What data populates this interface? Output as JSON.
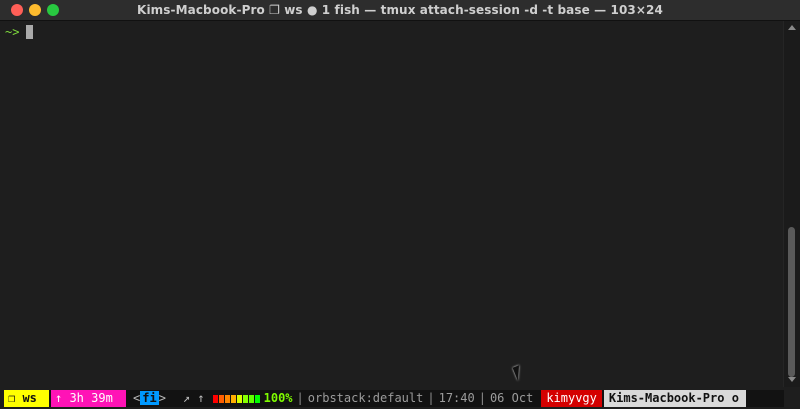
{
  "window": {
    "title": "Kims-Macbook-Pro ❐ ws ● 1 fish — tmux attach-session -d -t base — 103×24",
    "controls": {
      "close_color": "#ff5f57",
      "minimize_color": "#febc2e",
      "maximize_color": "#28c840"
    }
  },
  "terminal": {
    "prompt": "~>",
    "cursor_icon": "block-cursor-icon",
    "scrollbar": {
      "up_icon": "scroll-up-icon",
      "down_icon": "scroll-down-icon"
    }
  },
  "status": {
    "session": "❐ ws",
    "uptime": "↑ 3h 39m",
    "window_open": "<",
    "window_current": "fi",
    "window_close": ">",
    "net_down_arrow": "↗",
    "net_up_arrow": "↑",
    "battery_levels": [
      {
        "color": "#ff0000"
      },
      {
        "color": "#ff5f00"
      },
      {
        "color": "#ff8700"
      },
      {
        "color": "#ffaf00"
      },
      {
        "color": "#d7ff00"
      },
      {
        "color": "#87ff00"
      },
      {
        "color": "#5fff00"
      },
      {
        "color": "#00ff00"
      }
    ],
    "battery_percent": "100%",
    "separator": "|",
    "context": "orbstack:default",
    "time": "17:40",
    "date": "06 Oct",
    "user": "kimyvgy",
    "host": "Kims-Macbook-Pro o"
  },
  "mouse": {
    "icon": "mouse-pointer-icon"
  },
  "colors": {
    "terminal_background": "#1e1e1e",
    "prompt": "#7fdc3d",
    "session_background": "#ffff00",
    "uptime_background": "#ff13b6",
    "current_window_background": "#0099ff",
    "battery_percent": "#7ffc00",
    "user_background": "#d40000",
    "host_background": "#d9d9d9"
  }
}
